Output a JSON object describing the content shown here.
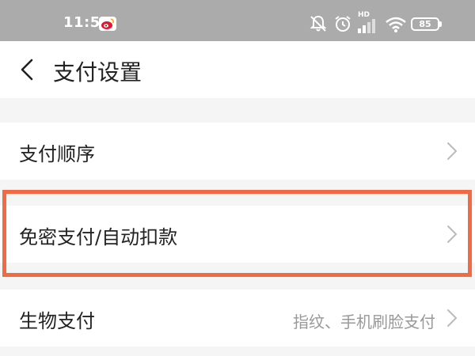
{
  "status_bar": {
    "time": "11:51",
    "battery": "85",
    "network_label": "HD",
    "icons": [
      "weibo-icon",
      "mute-icon",
      "alarm-icon",
      "signal-icon",
      "wifi-icon",
      "battery-icon"
    ]
  },
  "nav": {
    "title": "支付设置",
    "back_icon": "chevron-left-icon"
  },
  "rows": [
    {
      "label": "支付顺序",
      "value": ""
    },
    {
      "label": "免密支付/自动扣款",
      "value": ""
    },
    {
      "label": "生物支付",
      "value": "指纹、手机刷脸支付"
    }
  ],
  "colors": {
    "highlight": "#f26a43",
    "status_bar_bg": "#ababab",
    "page_bg": "#f5f5f5"
  }
}
